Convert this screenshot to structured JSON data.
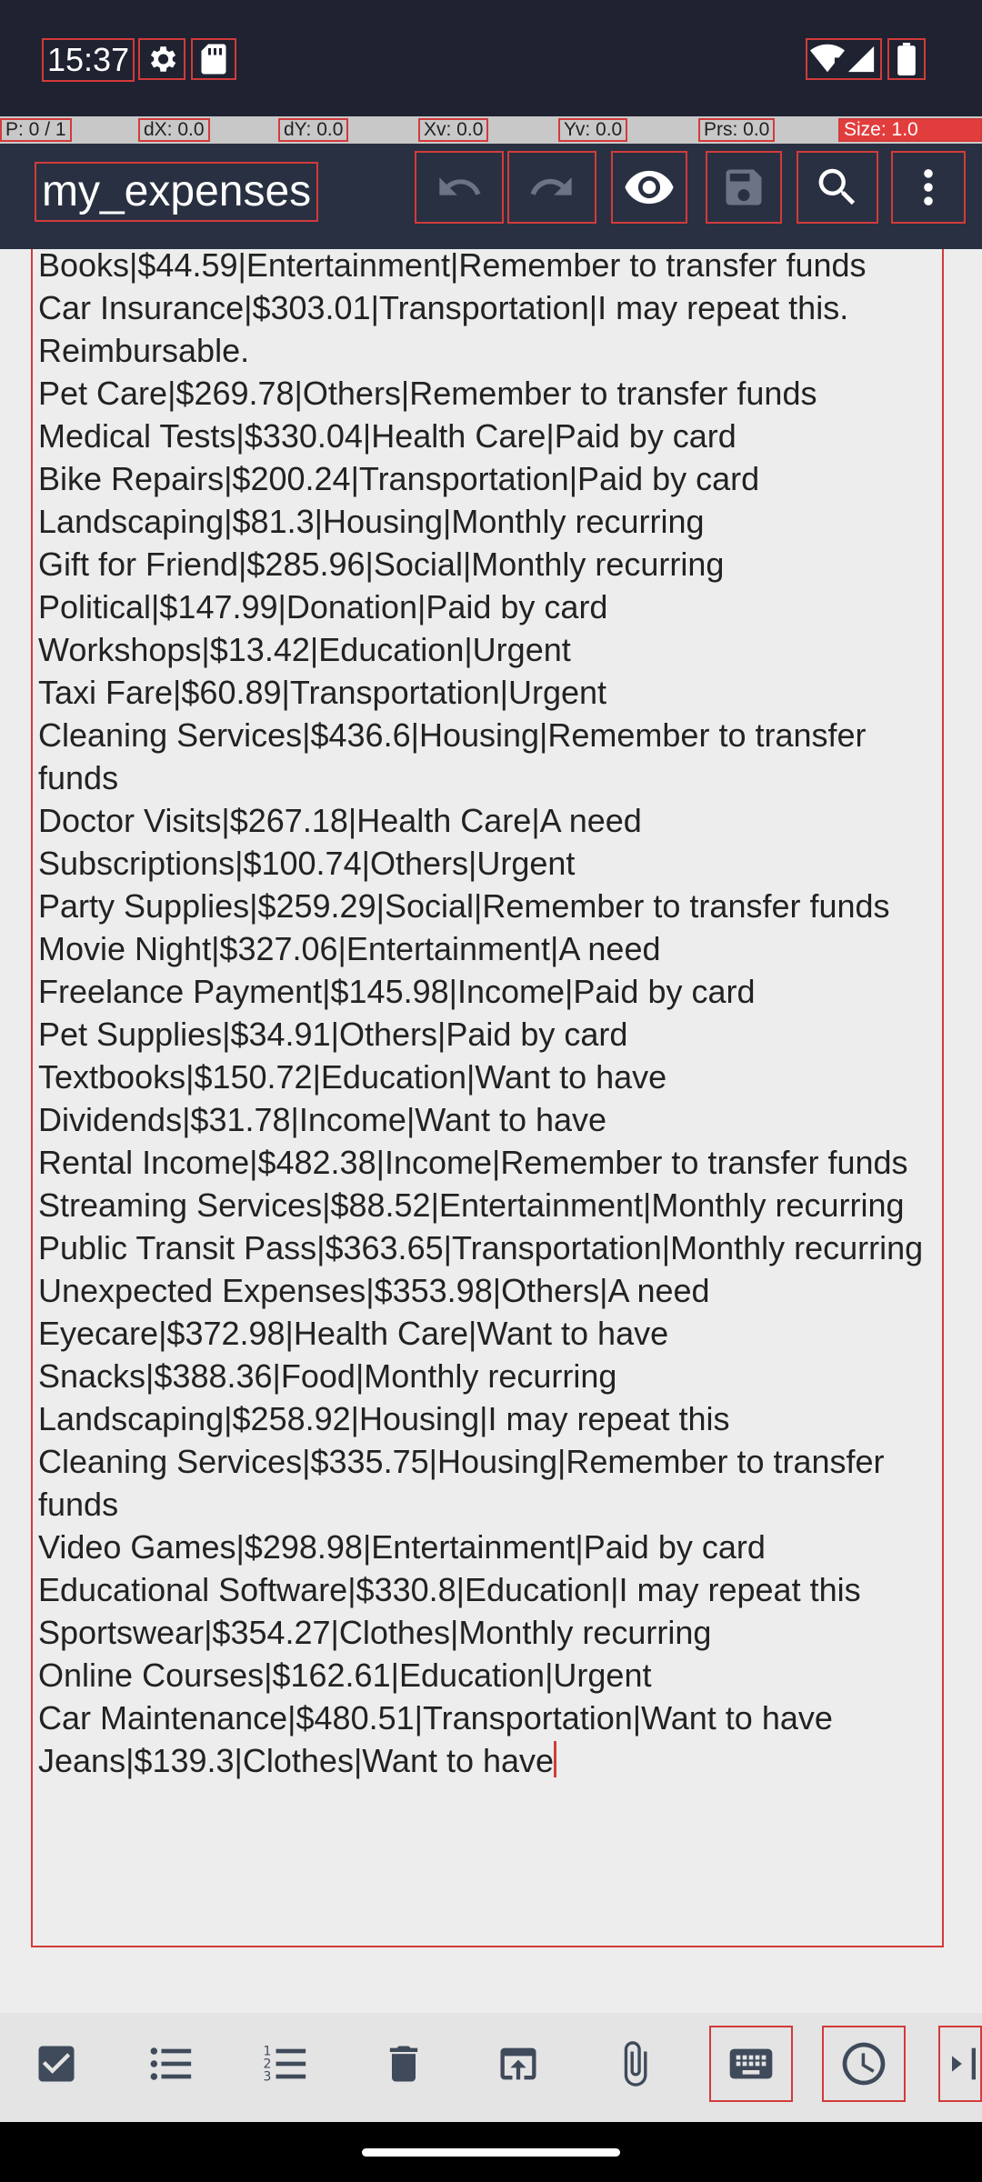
{
  "status_bar": {
    "time": "15:37",
    "icons": [
      "gear-icon",
      "sd-card-icon",
      "wifi-icon",
      "signal-icon",
      "battery-icon"
    ]
  },
  "pointer_bar": {
    "p": "P: 0 / 1",
    "dx": "dX: 0.0",
    "dy": "dY: 0.0",
    "xv": "Xv: 0.0",
    "yv": "Yv: 0.0",
    "prs": "Prs: 0.0",
    "size": "Size: 1.0"
  },
  "toolbar": {
    "title": "my_expenses",
    "buttons": [
      "undo-icon",
      "redo-icon",
      "eye-icon",
      "save-icon",
      "search-icon",
      "more-vert-icon"
    ]
  },
  "editor": {
    "lines": [
      "Books|$44.59|Entertainment|Remember to transfer funds",
      "Car Insurance|$303.01|Transportation|I may repeat this. Reimbursable.",
      "Pet Care|$269.78|Others|Remember to transfer funds",
      "Medical Tests|$330.04|Health Care|Paid by card",
      "Bike Repairs|$200.24|Transportation|Paid by card",
      "Landscaping|$81.3|Housing|Monthly recurring",
      "Gift for Friend|$285.96|Social|Monthly recurring",
      "Political|$147.99|Donation|Paid by card",
      "Workshops|$13.42|Education|Urgent",
      "Taxi Fare|$60.89|Transportation|Urgent",
      "Cleaning Services|$436.6|Housing|Remember to transfer funds",
      "Doctor Visits|$267.18|Health Care|A need",
      "Subscriptions|$100.74|Others|Urgent",
      "Party Supplies|$259.29|Social|Remember to transfer funds",
      "Movie Night|$327.06|Entertainment|A need",
      "Freelance Payment|$145.98|Income|Paid by card",
      "Pet Supplies|$34.91|Others|Paid by card",
      "Textbooks|$150.72|Education|Want to have",
      "Dividends|$31.78|Income|Want to have",
      "Rental Income|$482.38|Income|Remember to transfer funds",
      "Streaming Services|$88.52|Entertainment|Monthly recurring",
      "Public Transit Pass|$363.65|Transportation|Monthly recurring",
      "Unexpected Expenses|$353.98|Others|A need",
      "Eyecare|$372.98|Health Care|Want to have",
      "Snacks|$388.36|Food|Monthly recurring",
      "Landscaping|$258.92|Housing|I may repeat this",
      "Cleaning Services|$335.75|Housing|Remember to transfer funds",
      "Video Games|$298.98|Entertainment|Paid by card",
      "Educational Software|$330.8|Education|I may repeat this",
      "Sportswear|$354.27|Clothes|Monthly recurring",
      "Online Courses|$162.61|Education|Urgent",
      "Car Maintenance|$480.51|Transportation|Want to have",
      "Jeans|$139.3|Clothes|Want to have"
    ]
  },
  "bottom_bar": {
    "buttons": [
      "checkbox-icon",
      "bulleted-list-icon",
      "numbered-list-icon",
      "delete-icon",
      "open-in-new-icon",
      "attach-icon",
      "keyboard-icon",
      "clock-icon",
      "indent-icon"
    ]
  },
  "colors": {
    "toolbar_bg": "#293041",
    "status_bg": "#1f2230",
    "highlight": "#d23b3b"
  }
}
